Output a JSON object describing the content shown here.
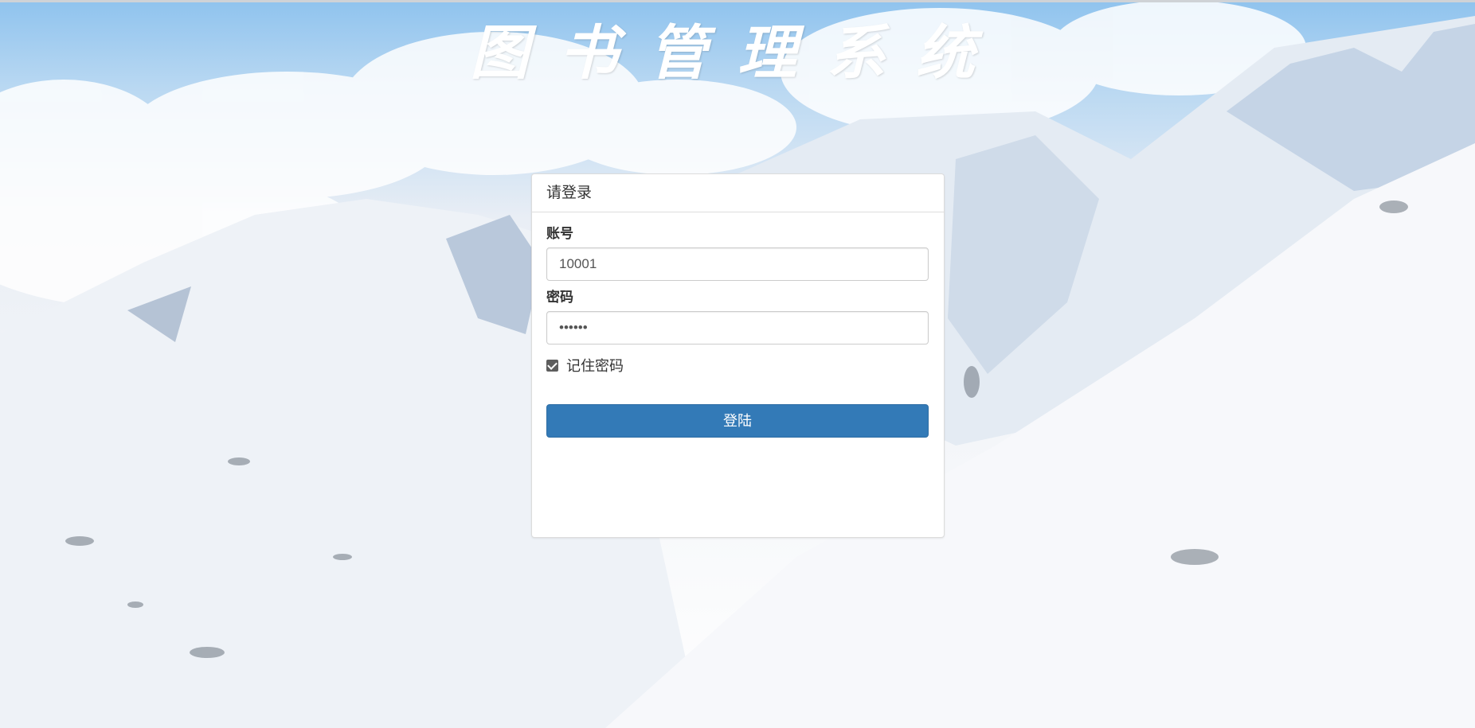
{
  "page": {
    "title": "图书管理系统"
  },
  "login_panel": {
    "heading": "请登录",
    "account_label": "账号",
    "account_value": "10001",
    "password_label": "密码",
    "password_value": "••••••",
    "remember_label": "记住密码",
    "remember_checked": true,
    "submit_label": "登陆"
  },
  "colors": {
    "primary_button": "#337ab7",
    "sky": "#8fc3ee",
    "snow": "#f4f6f9"
  }
}
